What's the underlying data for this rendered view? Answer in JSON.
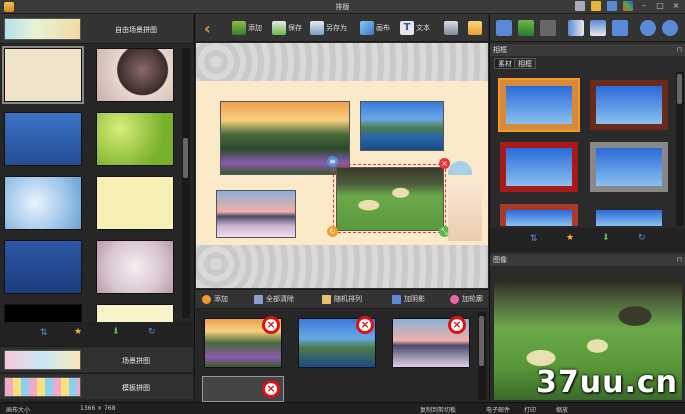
{
  "window": {
    "title": "排版"
  },
  "left_panel": {
    "header_label": "自由场景拼图",
    "tabs": [
      {
        "label": "场景拼图"
      },
      {
        "label": "模板拼图"
      }
    ]
  },
  "toolbar": {
    "buttons": [
      {
        "label": "添加",
        "icon": "add-image-icon"
      },
      {
        "label": "保存",
        "icon": "save-icon"
      },
      {
        "label": "另存为",
        "icon": "save-as-icon"
      },
      {
        "label": "画布",
        "icon": "canvas-icon"
      },
      {
        "label": "文本",
        "icon": "text-icon"
      }
    ]
  },
  "list_toolbar": {
    "buttons": [
      {
        "label": "添加",
        "icon": "add-circle-icon"
      },
      {
        "label": "全部清除",
        "icon": "clear-all-icon"
      },
      {
        "label": "随机排列",
        "icon": "shuffle-icon"
      },
      {
        "label": "加阴影",
        "icon": "shadow-icon"
      },
      {
        "label": "加轮廓",
        "icon": "outline-icon"
      }
    ]
  },
  "right_panel": {
    "frames_header": "相框",
    "subtabs": [
      {
        "label": "素材"
      },
      {
        "label": "相框"
      }
    ],
    "preview_header": "图像"
  },
  "status": {
    "canvas_label": "画布大小",
    "canvas_size": "1366 × 768",
    "copy_clipboard": "复制到剪切板",
    "email": "电子邮件",
    "print": "打印",
    "zoom": "缩放"
  },
  "watermark": "37uu.cn",
  "colors": {
    "accent_orange": "#f09a2a",
    "delete_red": "#d11111",
    "selection_red": "#e33333"
  }
}
